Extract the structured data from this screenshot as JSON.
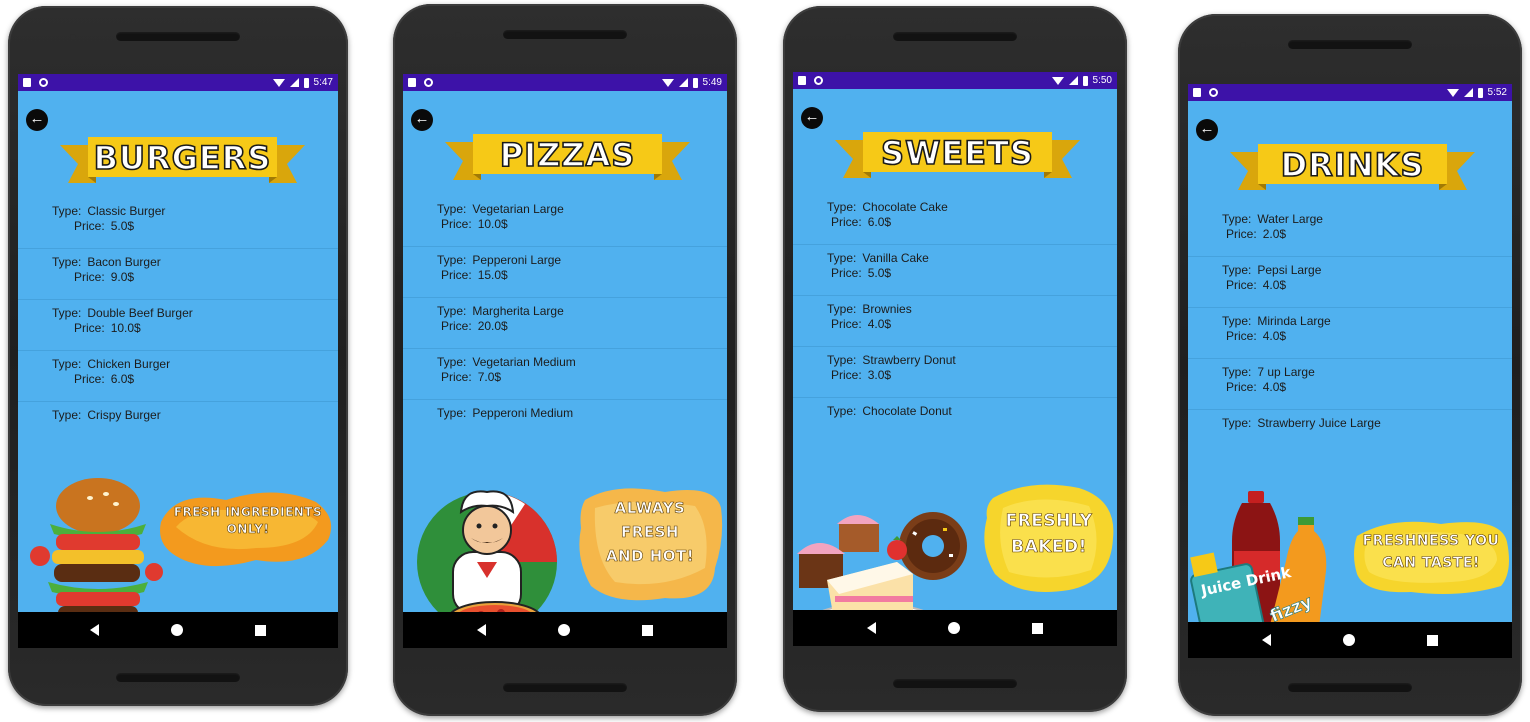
{
  "screens": [
    {
      "time": "5:47",
      "title": "BURGERS",
      "items": [
        {
          "type_label": "Type:",
          "type": "Classic Burger",
          "price_label": "Price:",
          "price": "5.0$"
        },
        {
          "type_label": "Type:",
          "type": "Bacon Burger",
          "price_label": "Price:",
          "price": "9.0$"
        },
        {
          "type_label": "Type:",
          "type": "Double Beef Burger",
          "price_label": "Price:",
          "price": "10.0$"
        },
        {
          "type_label": "Type:",
          "type": "Chicken Burger",
          "price_label": "Price:",
          "price": "6.0$"
        },
        {
          "type_label": "Type:",
          "type": "Crispy Burger"
        }
      ],
      "slogan_line1": "FRESH INGREDIENTS",
      "slogan_line2": "ONLY!",
      "slogan_line3": ""
    },
    {
      "time": "5:49",
      "title": "PIZZAS",
      "items": [
        {
          "type_label": "Type:",
          "type": "Vegetarian Large",
          "price_label": "Price:",
          "price": "10.0$"
        },
        {
          "type_label": "Type:",
          "type": "Pepperoni Large",
          "price_label": "Price:",
          "price": "15.0$"
        },
        {
          "type_label": "Type:",
          "type": "Margherita Large",
          "price_label": "Price:",
          "price": "20.0$"
        },
        {
          "type_label": "Type:",
          "type": "Vegetarian Medium",
          "price_label": "Price:",
          "price": "7.0$"
        },
        {
          "type_label": "Type:",
          "type": "Pepperoni Medium"
        }
      ],
      "slogan_line1": "ALWAYS",
      "slogan_line2": "FRESH",
      "slogan_line3": "AND HOT!"
    },
    {
      "time": "5:50",
      "title": "SWEETS",
      "items": [
        {
          "type_label": "Type:",
          "type": "Chocolate Cake",
          "price_label": "Price:",
          "price": "6.0$"
        },
        {
          "type_label": "Type:",
          "type": "Vanilla Cake",
          "price_label": "Price:",
          "price": "5.0$"
        },
        {
          "type_label": "Type:",
          "type": "Brownies",
          "price_label": "Price:",
          "price": "4.0$"
        },
        {
          "type_label": "Type:",
          "type": "Strawberry Donut",
          "price_label": "Price:",
          "price": "3.0$"
        },
        {
          "type_label": "Type:",
          "type": "Chocolate Donut"
        }
      ],
      "slogan_line1": "FRESHLY",
      "slogan_line2": "BAKED!",
      "slogan_line3": ""
    },
    {
      "time": "5:52",
      "title": "DRINKS",
      "items": [
        {
          "type_label": "Type:",
          "type": "Water Large",
          "price_label": "Price:",
          "price": "2.0$"
        },
        {
          "type_label": "Type:",
          "type": "Pepsi Large",
          "price_label": "Price:",
          "price": "4.0$"
        },
        {
          "type_label": "Type:",
          "type": "Mirinda Large",
          "price_label": "Price:",
          "price": "4.0$"
        },
        {
          "type_label": "Type:",
          "type": "7 up Large",
          "price_label": "Price:",
          "price": "4.0$"
        },
        {
          "type_label": "Type:",
          "type": "Strawberry Juice Large"
        }
      ],
      "slogan_line1": "FRESHNESS YOU",
      "slogan_line2": "CAN TASTE!",
      "slogan_line3": "",
      "juice_label": "Juice Drink",
      "soda_label": "fizzy"
    }
  ],
  "colors": {
    "screen_bg": "#50b1ef",
    "status_bar": "#3d12a8",
    "ribbon": "#f6c917",
    "nav_bar": "#000000"
  },
  "icons": {
    "back": "arrow-left-icon",
    "nav_back": "triangle-back-icon",
    "nav_home": "circle-home-icon",
    "nav_recents": "square-recents-icon"
  }
}
